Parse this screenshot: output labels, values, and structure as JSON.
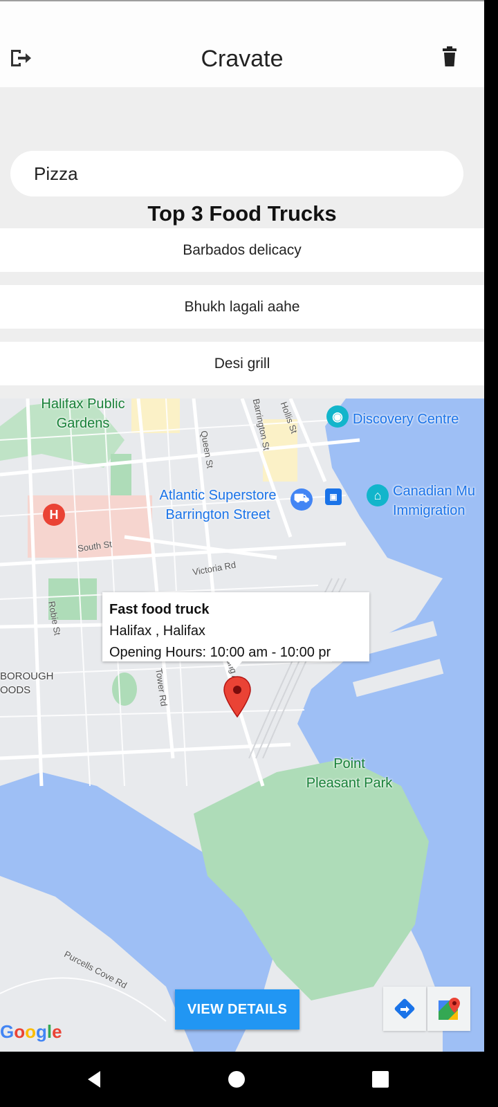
{
  "app": {
    "title": "Cravate"
  },
  "search": {
    "value": "Pizza",
    "placeholder": ""
  },
  "top_trucks": {
    "heading": "Top 3 Food Trucks",
    "items": [
      "Barbados delicacy",
      "Bhukh lagali aahe",
      "Desi grill"
    ]
  },
  "map": {
    "places": {
      "halifax_public_gardens": "Halifax Public\nGardens",
      "discovery_centre": "Discovery Centre",
      "atlantic_superstore": "Atlantic Superstore\nBarrington Street",
      "canadian_museum": "Canadian Mu\nImmigration",
      "point_pleasant_park": "Point\nPleasant Park",
      "neighbourhood": "BOROUGH\nOODS"
    },
    "streets": {
      "queen": "Queen St",
      "barrington": "Barrington St",
      "hollis": "Hollis St",
      "south": "South St",
      "victoria": "Victoria Rd",
      "robie": "Robie St",
      "tower": "Tower Rd",
      "young": "Young Ave",
      "purcells": "Purcells Cove Rd"
    },
    "info_window": {
      "name": "Fast food truck",
      "address": "Halifax , Halifax",
      "hours": "Opening Hours: 10:00 am - 10:00 pr"
    },
    "view_details_label": "VIEW DETAILS",
    "attribution": "Google",
    "colors": {
      "water": "#9ebff5",
      "park": "#aedcb8",
      "land": "#e8eaed",
      "pin": "#ea4335",
      "button": "#2196f3"
    }
  },
  "icons": {
    "logout": "logout-icon",
    "trash": "trash-icon",
    "directions": "directions-icon",
    "maps": "google-maps-icon"
  }
}
